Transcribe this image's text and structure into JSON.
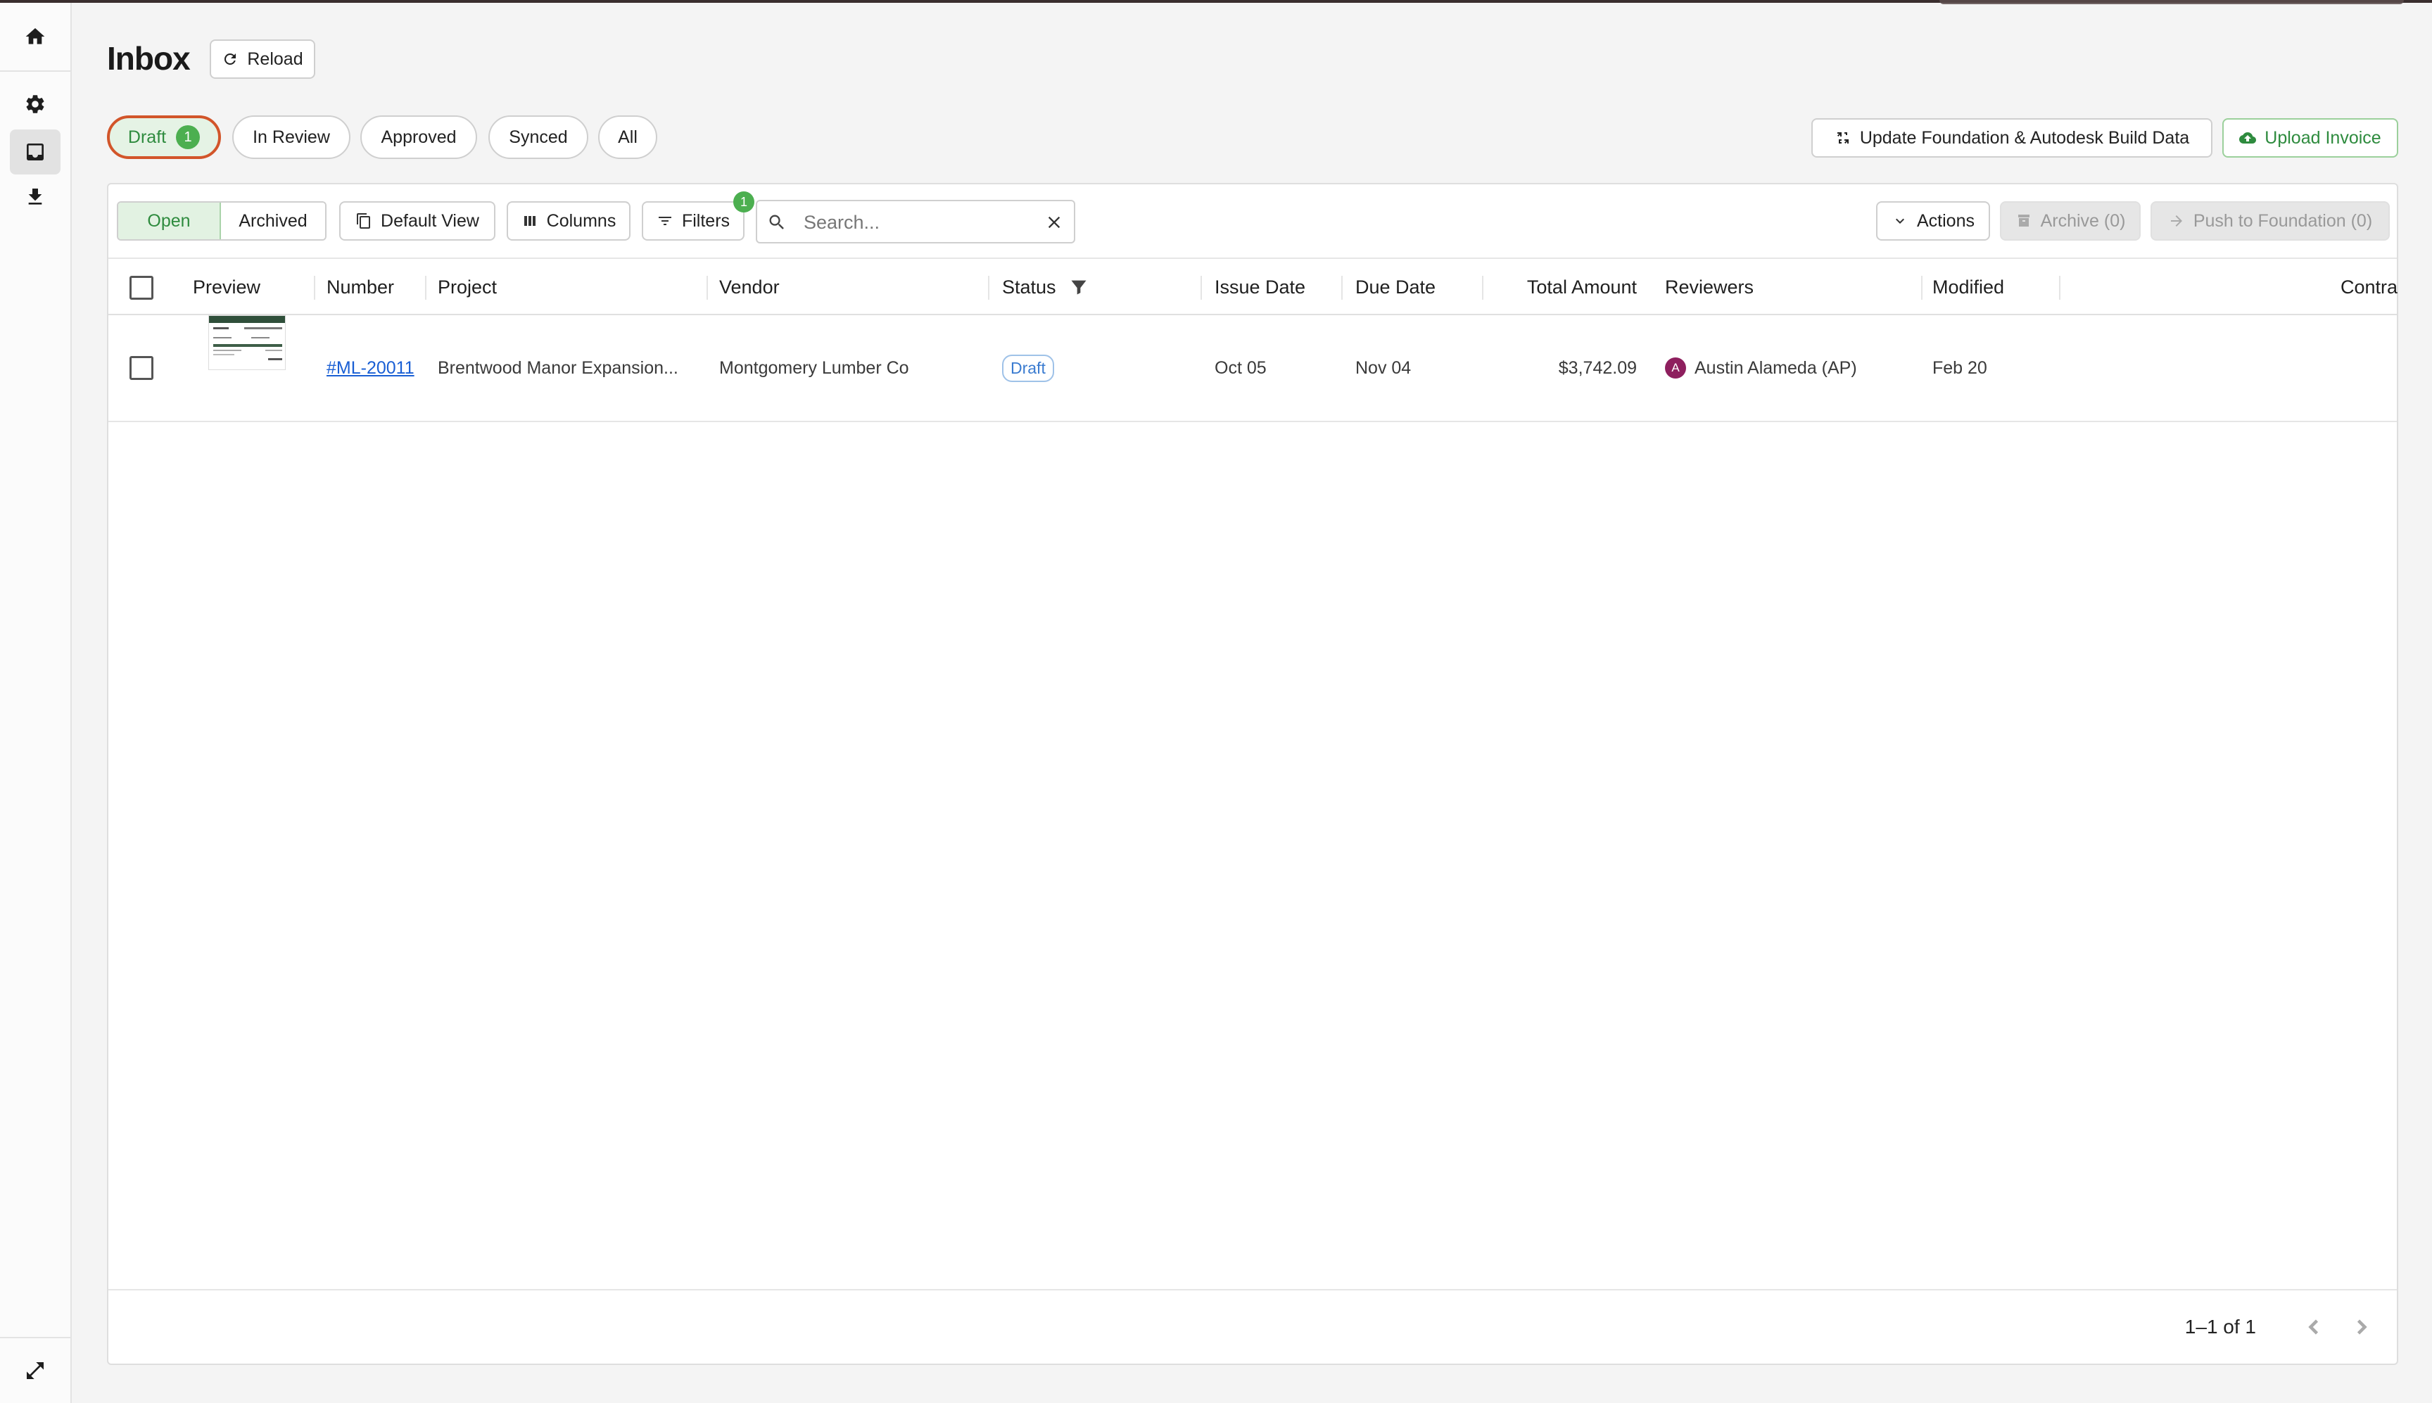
{
  "sidebar": {
    "items": [
      {
        "name": "home",
        "icon": "home-icon"
      },
      {
        "name": "settings",
        "icon": "gear-icon"
      },
      {
        "name": "inbox",
        "icon": "inbox-icon",
        "active": true
      },
      {
        "name": "downloads",
        "icon": "download-icon"
      }
    ],
    "bottom_icon": "expand-icon"
  },
  "header": {
    "title": "Inbox",
    "reload_label": "Reload"
  },
  "status_tabs": [
    {
      "label": "Draft",
      "count": "1",
      "active": true
    },
    {
      "label": "In Review"
    },
    {
      "label": "Approved"
    },
    {
      "label": "Synced"
    },
    {
      "label": "All"
    }
  ],
  "header_actions": {
    "update_label": "Update Foundation & Autodesk Build Data",
    "upload_label": "Upload Invoice"
  },
  "toolbar": {
    "open_label": "Open",
    "archived_label": "Archived",
    "view_label": "Default View",
    "columns_label": "Columns",
    "filters_label": "Filters",
    "filters_count": "1",
    "search_placeholder": "Search...",
    "search_value": "",
    "actions_label": "Actions",
    "archive_label": "Archive (0)",
    "push_label": "Push to Foundation (0)"
  },
  "table": {
    "columns": [
      "Preview",
      "Number",
      "Project",
      "Vendor",
      "Status",
      "Issue Date",
      "Due Date",
      "Total Amount",
      "Reviewers",
      "Modified",
      "Contra"
    ],
    "rows": [
      {
        "number": "#ML-20011",
        "project": "Brentwood Manor Expansion...",
        "vendor": "Montgomery Lumber Co",
        "status": "Draft",
        "issue_date": "Oct 05",
        "due_date": "Nov 04",
        "total_amount": "$3,742.09",
        "reviewer_initial": "A",
        "reviewer": "Austin Alameda (AP)",
        "modified": "Feb 20"
      }
    ]
  },
  "pagination": {
    "range_text": "1–1 of 1"
  },
  "colors": {
    "accent_green": "#2e8b3e",
    "badge_green": "#4caf50",
    "active_outline": "#d2552a",
    "link_blue": "#1a5fd4",
    "avatar": "#8e1f5e"
  }
}
